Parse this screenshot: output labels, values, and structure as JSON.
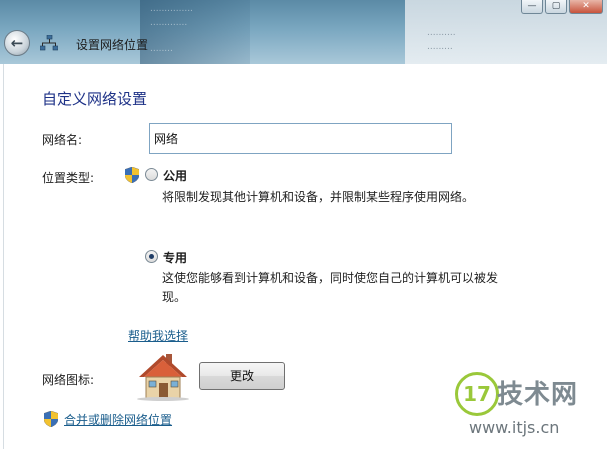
{
  "window": {
    "title": "设置网络位置",
    "background_fragments": [
      "...............",
      ".............",
      "........",
      "..........",
      "........."
    ],
    "min_label": "—",
    "max_label": "▢",
    "close_label": "✕"
  },
  "colors": {
    "heading": "#1e3287",
    "link": "#1a5d8c",
    "accent": "#7fa4c2"
  },
  "page": {
    "heading": "自定义网络设置",
    "network_name_label": "网络名:",
    "network_name_value": "网络",
    "location_type_label": "位置类型:",
    "public_option": {
      "label": "公用",
      "description": "将限制发现其他计算机和设备，并限制某些程序使用网络。",
      "selected": false
    },
    "private_option": {
      "label": "专用",
      "description_line1": "这使您能够看到计算机和设备，同时使您自己的计算机可以被发",
      "description_line2": "现。",
      "selected": true
    },
    "help_link": "帮助我选择",
    "network_icon_label": "网络图标:",
    "change_button": "更改",
    "merge_link": "合并或删除网络位置"
  },
  "watermark": {
    "badge": "17",
    "text": "技术网",
    "url": "www.itjs.cn"
  },
  "icons": {
    "back": "back-arrow-icon",
    "network": "network-icon",
    "shield": "uac-shield-icon",
    "house": "house-icon"
  }
}
